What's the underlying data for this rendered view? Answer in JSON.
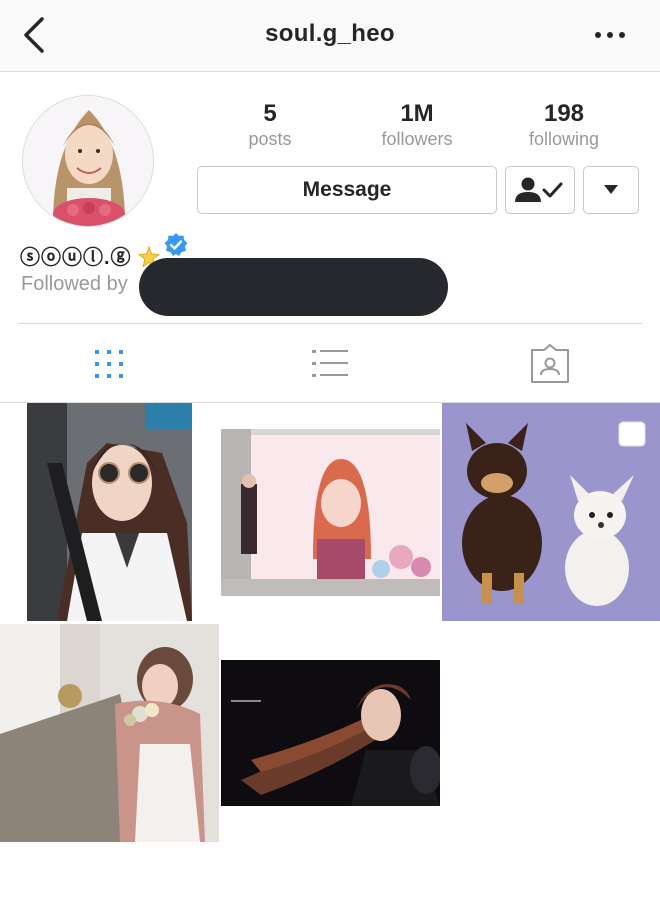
{
  "header": {
    "username": "soul.g_heo",
    "back_icon": "chevron-left-icon",
    "more_icon": "more-dots-icon"
  },
  "profile": {
    "display_name": "ⓢⓞⓤⓛ.ⓖ",
    "name_emoji": "star-icon",
    "verified_icon": "verified-badge-icon",
    "followed_by_label": "Followed by",
    "avatar_icon": "profile-photo"
  },
  "stats": [
    {
      "value": "5",
      "label": "posts"
    },
    {
      "value": "1M",
      "label": "followers"
    },
    {
      "value": "198",
      "label": "following"
    }
  ],
  "actions": {
    "message_label": "Message",
    "following_icon": "person-check-icon",
    "dropdown_icon": "caret-down-icon"
  },
  "tabs": [
    {
      "name": "grid-view",
      "icon": "grid-icon",
      "active": true
    },
    {
      "name": "list-view",
      "icon": "list-icon",
      "active": false
    },
    {
      "name": "tagged",
      "icon": "tagged-person-icon",
      "active": false
    }
  ],
  "colors": {
    "accent": "#3897f0",
    "verified": "#3897f0",
    "inactive_icon": "#999999",
    "redaction": "#262a2e"
  },
  "posts": [
    {
      "subject": "selfie in car with sunglasses"
    },
    {
      "subject": "subway billboard advertisement"
    },
    {
      "subject": "two chihuahua dogs on purple background",
      "multi_image": true
    },
    {
      "subject": "woman holding flower bouquet by window"
    },
    {
      "subject": "performer on stage with flowing hair"
    }
  ]
}
